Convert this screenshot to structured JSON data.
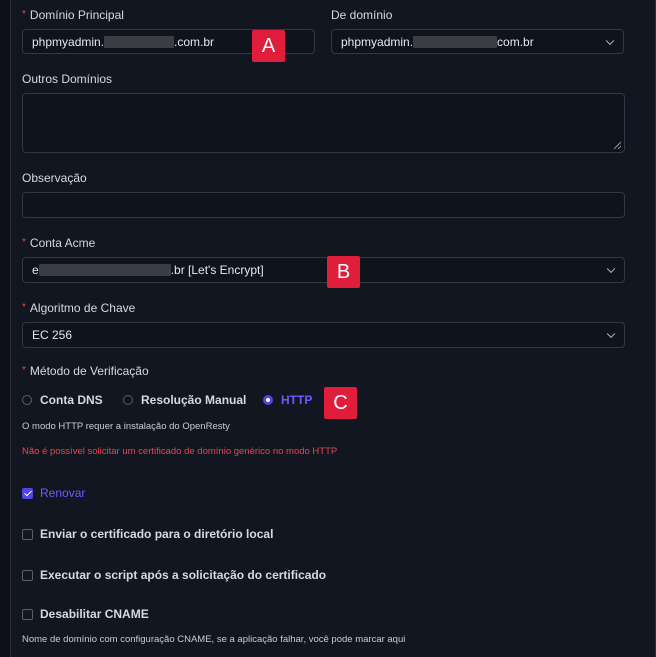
{
  "form": {
    "main_domain": {
      "label": "Domínio Principal",
      "prefix": "phpmyadmin.",
      "suffix": ".com.br"
    },
    "from_domain": {
      "label": "De domínio",
      "prefix": "phpmyadmin.",
      "suffix": "com.br"
    },
    "other_domains": {
      "label": "Outros Domínios",
      "value": ""
    },
    "observation": {
      "label": "Observação",
      "value": ""
    },
    "acme_account": {
      "label": "Conta Acme",
      "prefix": "e",
      "suffix": ".br [Let's Encrypt]"
    },
    "key_algorithm": {
      "label": "Algoritmo de Chave",
      "value": "EC 256"
    },
    "verification": {
      "label": "Método de Verificação",
      "options": [
        "Conta DNS",
        "Resolução Manual",
        "HTTP"
      ],
      "selected": "HTTP",
      "note": "O modo HTTP requer a instalação do OpenResty",
      "error": "Não é possível solicitar um certificado de domínio genérico no modo HTTP"
    },
    "checkboxes": {
      "renew": {
        "label": "Renovar",
        "checked": true
      },
      "send_local": {
        "label": "Enviar o certificado para o diretório local",
        "checked": false
      },
      "run_script": {
        "label": "Executar o script após a solicitação do certificado",
        "checked": false
      },
      "disable_cname": {
        "label": "Desabilitar CNAME",
        "checked": false
      }
    },
    "cname_note": "Nome de domínio com configuração CNAME, se a aplicação falhar, você pode marcar aqui"
  },
  "annotations": {
    "a": "A",
    "b": "B",
    "c": "C"
  },
  "colors": {
    "accent": "#4f46e5",
    "error": "#e5484d",
    "badge": "#e01e3c"
  }
}
